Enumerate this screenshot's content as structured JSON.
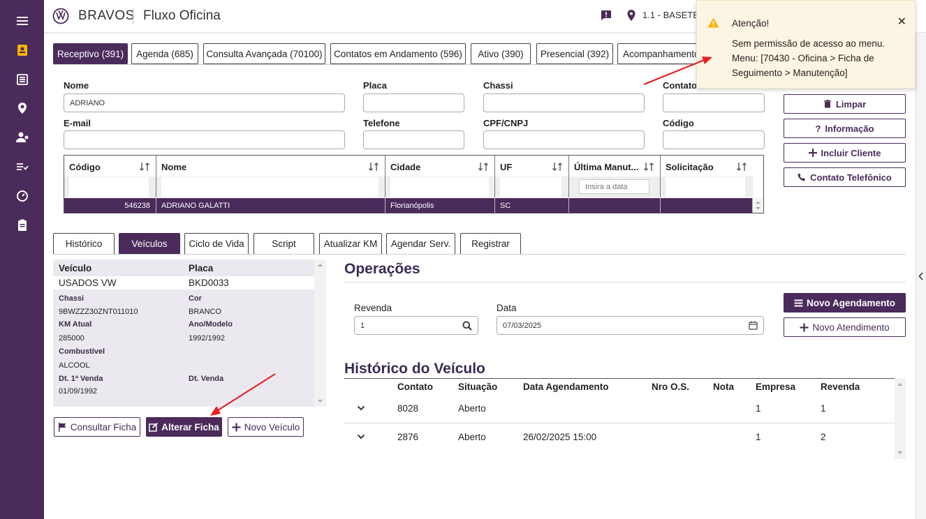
{
  "header": {
    "brand": "BRAVOS",
    "module": "Fluxo Oficina",
    "location": "1.1 - BASETES"
  },
  "tabs": [
    "Receptivo (391)",
    "Agenda (685)",
    "Consulta Avançada (70100)",
    "Contatos em Andamento (596)",
    "Ativo (390)",
    "Presencial (392)",
    "Acompanhamento"
  ],
  "form": {
    "nome_label": "Nome",
    "nome_value": "ADRIANO",
    "placa_label": "Placa",
    "chassi_label": "Chassi",
    "contato_label": "Contato",
    "email_label": "E-mail",
    "telefone_label": "Telefone",
    "cpf_label": "CPF/CNPJ",
    "codigo_label": "Código"
  },
  "actions": {
    "limpar": "Limpar",
    "informacao": "Informação",
    "incluir": "Incluir Cliente",
    "contato_tel": "Contato Telefônico"
  },
  "grid": {
    "headers": [
      "Código",
      "Nome",
      "Cidade",
      "UF",
      "Última Manut...",
      "Solicitação"
    ],
    "date_placeholder": "Insira a data",
    "row": {
      "codigo": "546238",
      "nome": "ADRIANO GALATTI",
      "cidade": "Florianópolis",
      "uf": "SC"
    }
  },
  "subtabs": [
    "Histórico",
    "Veículos",
    "Ciclo de Vida",
    "Script",
    "Atualizar KM",
    "Agendar Serv.",
    "Registrar"
  ],
  "vehicle": {
    "veiculo_label": "Veículo",
    "placa_label": "Placa",
    "veiculo": "USADOS VW",
    "placa": "BKD0033",
    "chassi_label": "Chassi",
    "chassi": "9BWZZZ30ZNT011010",
    "cor_label": "Cor",
    "cor": "BRANCO",
    "km_label": "KM Atual",
    "km": "285000",
    "ano_label": "Ano/Modelo",
    "ano": "1992/1992",
    "comb_label": "Combustível",
    "comb": "ALCOOL",
    "dt1_label": "Dt. 1ª Venda",
    "dt1": "01/09/1992",
    "dtv_label": "Dt. Venda"
  },
  "vehicle_buttons": {
    "consultar": "Consultar Ficha",
    "alterar": "Alterar Ficha",
    "novo": "Novo Veículo"
  },
  "operacoes": {
    "title": "Operações",
    "revenda_label": "Revenda",
    "revenda_value": "1",
    "data_label": "Data",
    "data_value": "07/03/2025",
    "novo_agendamento": "Novo Agendamento",
    "novo_atendimento": "Novo Atendimento"
  },
  "historico": {
    "title": "Histórico do Veículo",
    "headers": [
      "Contato",
      "Situação",
      "Data Agendamento",
      "Nro O.S.",
      "Nota",
      "Empresa",
      "Revenda"
    ],
    "rows": [
      {
        "contato": "8028",
        "situacao": "Aberto",
        "data": "",
        "os": "",
        "nota": "",
        "empresa": "1",
        "revenda": "1"
      },
      {
        "contato": "2876",
        "situacao": "Aberto",
        "data": "26/02/2025 15:00",
        "os": "",
        "nota": "",
        "empresa": "1",
        "revenda": "2"
      }
    ]
  },
  "toast": {
    "title": "Atenção!",
    "message": "Sem permissão de acesso ao menu. Menu: [70430 - Oficina > Ficha de Seguimento > Manutenção]"
  },
  "colors": {
    "primary": "#4b2a5c",
    "warning": "#f5b400",
    "annotation": "#e8201f"
  }
}
